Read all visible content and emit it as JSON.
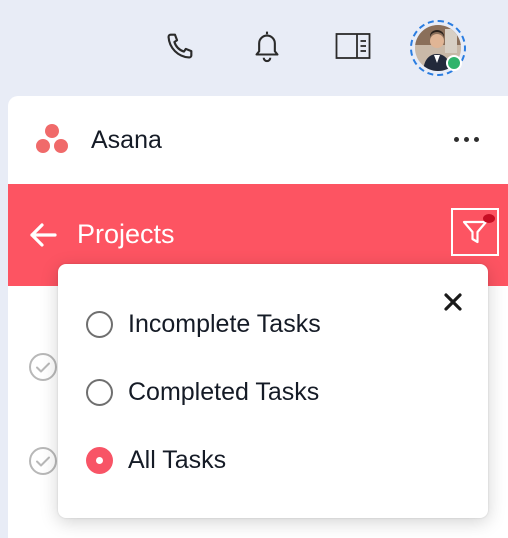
{
  "topbar": {
    "icons": [
      "phone-icon",
      "bell-icon",
      "side-panel-icon"
    ],
    "avatar_status_color": "#2fb36b"
  },
  "app": {
    "name": "Asana",
    "logo_color": "#f06a6a",
    "more_icon": "ellipsis-icon"
  },
  "projects_bar": {
    "title": "Projects",
    "background": "#fd5462",
    "back_icon": "arrow-left-icon",
    "filter_icon": "filter-icon",
    "filter_active": true
  },
  "filter_menu": {
    "close_icon": "close-icon",
    "options": [
      {
        "label": "Incomplete Tasks",
        "selected": false
      },
      {
        "label": "Completed Tasks",
        "selected": false
      },
      {
        "label": "All Tasks",
        "selected": true
      }
    ],
    "accent": "#f85466"
  }
}
